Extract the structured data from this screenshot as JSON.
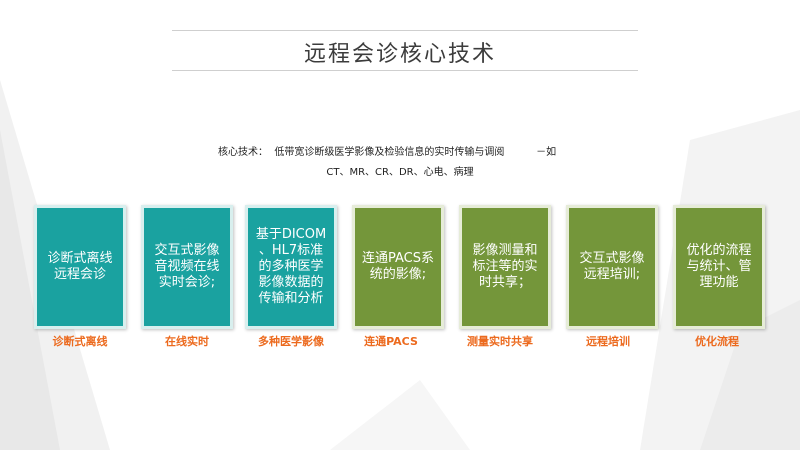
{
  "title": "远程会诊核心技术",
  "description": {
    "line1": "核心技术：  低带宽诊断级医学影像及检验信息的实时传输与调阅          －如",
    "line2": "CT、MR、CR、DR、心电、病理"
  },
  "boxes": [
    {
      "text": "诊断式离线远程会诊",
      "label": "诊断式离线",
      "color": "#1aa2a0"
    },
    {
      "text": "交互式影像音视频在线实时会诊;",
      "label": "在线实时",
      "color": "#1aa2a0"
    },
    {
      "text": "基于DICOM 、HL7标准的多种医学影像数据的传输和分析",
      "label": "多种医学影像",
      "color": "#1aa2a0"
    },
    {
      "text": "连通PACS系统的影像;",
      "label": "连通PACS",
      "color": "#74963a"
    },
    {
      "text": "影像测量和标注等的实时共享；",
      "label": "测量实时共享",
      "color": "#74963a"
    },
    {
      "text": "交互式影像远程培训;",
      "label": "远程培训",
      "color": "#74963a"
    },
    {
      "text": "优化的流程与统计、管理功能",
      "label": "优化流程",
      "color": "#74963a"
    }
  ],
  "label_color": "#ec6a1e"
}
